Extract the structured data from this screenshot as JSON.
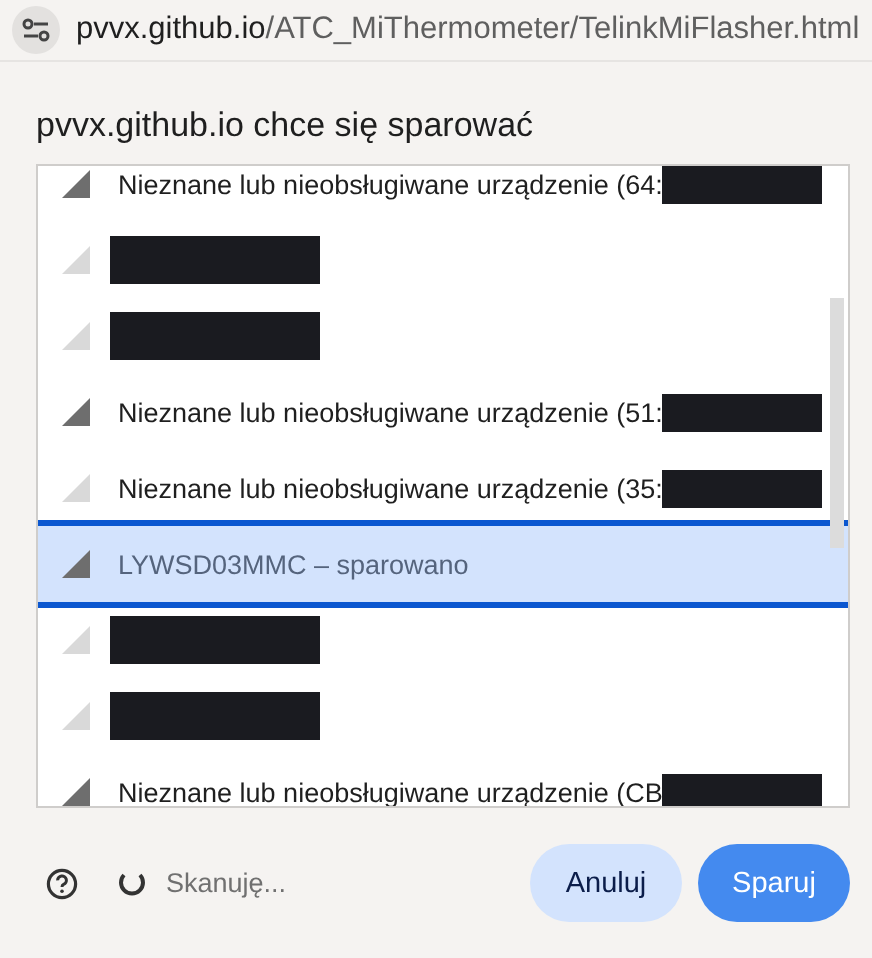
{
  "address_bar": {
    "host": "pvvx.github.io",
    "path": "/ATC_MiThermometer/TelinkMiFlasher.html"
  },
  "dialog": {
    "title": "pvvx.github.io chce się sparować",
    "devices": [
      {
        "kind": "device",
        "label": "Nieznane lub nieobsługiwane urządzenie (64:",
        "faint": false,
        "redacted_tail": true,
        "selected": false
      },
      {
        "kind": "redacted",
        "faint": true,
        "selected": false
      },
      {
        "kind": "redacted",
        "faint": true,
        "selected": false
      },
      {
        "kind": "device",
        "label": "Nieznane lub nieobsługiwane urządzenie (51:",
        "faint": false,
        "redacted_tail": true,
        "selected": false
      },
      {
        "kind": "device",
        "label": "Nieznane lub nieobsługiwane urządzenie (35:",
        "faint": true,
        "redacted_tail": true,
        "selected": false
      },
      {
        "kind": "device",
        "label": "LYWSD03MMC – sparowano",
        "faint": false,
        "redacted_tail": false,
        "selected": true
      },
      {
        "kind": "redacted",
        "faint": true,
        "selected": false
      },
      {
        "kind": "redacted",
        "faint": true,
        "selected": false
      },
      {
        "kind": "device",
        "label": "Nieznane lub nieobsługiwane urządzenie (CB",
        "faint": false,
        "redacted_tail": true,
        "selected": false
      }
    ],
    "status": "Skanuję...",
    "buttons": [
      {
        "kind": "secondary",
        "label": "Anuluj"
      },
      {
        "kind": "primary",
        "label": "Sparuj"
      }
    ]
  }
}
